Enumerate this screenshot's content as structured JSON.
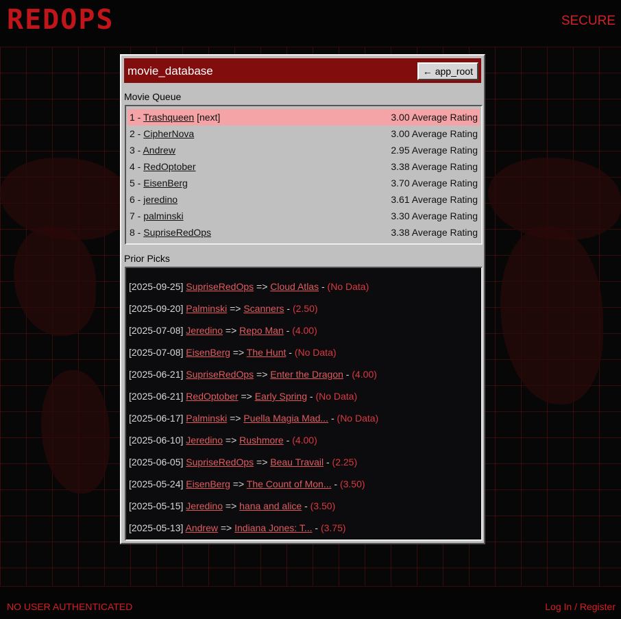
{
  "header": {
    "logo": "REDOPS",
    "status": "SECURE"
  },
  "footer": {
    "auth_status": "NO USER AUTHENTICATED",
    "login_link": "Log In / Register"
  },
  "window": {
    "title": "movie_database",
    "back_button": "app_root",
    "back_icon": "left-arrow-icon"
  },
  "queue": {
    "label": "Movie Queue",
    "items": [
      {
        "pos": "1 - ",
        "name": "Trashqueen",
        "tag": " [next]",
        "rating": "3.00 Average Rating",
        "active": true
      },
      {
        "pos": "2 - ",
        "name": "CipherNova",
        "tag": "",
        "rating": "3.00 Average Rating"
      },
      {
        "pos": "3 - ",
        "name": "Andrew",
        "tag": "",
        "rating": "2.95 Average Rating"
      },
      {
        "pos": "4 - ",
        "name": "RedOptober",
        "tag": "",
        "rating": "3.38 Average Rating"
      },
      {
        "pos": "5 - ",
        "name": "EisenBerg",
        "tag": "",
        "rating": "3.70 Average Rating"
      },
      {
        "pos": "6 - ",
        "name": "jeredino",
        "tag": "",
        "rating": "3.61 Average Rating"
      },
      {
        "pos": "7 - ",
        "name": "palminski",
        "tag": "",
        "rating": "3.30 Average Rating"
      },
      {
        "pos": "8 - ",
        "name": "SupriseRedOps",
        "tag": "",
        "rating": "3.38 Average Rating"
      }
    ]
  },
  "picks": {
    "label": "Prior Picks",
    "items": [
      {
        "date": "[2025-09-25] ",
        "user": "SupriseRedOps",
        "arrow": " => ",
        "movie": "Cloud Atlas",
        "sep": " - ",
        "rating": "(No Data)"
      },
      {
        "date": "[2025-09-20] ",
        "user": "Palminski",
        "arrow": " => ",
        "movie": "Scanners",
        "sep": " - ",
        "rating": "(2.50)"
      },
      {
        "date": "[2025-07-08] ",
        "user": "Jeredino",
        "arrow": " => ",
        "movie": "Repo Man",
        "sep": " - ",
        "rating": "(4.00)"
      },
      {
        "date": "[2025-07-08] ",
        "user": "EisenBerg",
        "arrow": " => ",
        "movie": "The Hunt",
        "sep": " - ",
        "rating": "(No Data)"
      },
      {
        "date": "[2025-06-21] ",
        "user": "SupriseRedOps",
        "arrow": " => ",
        "movie": "Enter the Dragon",
        "sep": " - ",
        "rating": "(4.00)"
      },
      {
        "date": "[2025-06-21] ",
        "user": "RedOptober",
        "arrow": " => ",
        "movie": "Early Spring",
        "sep": " - ",
        "rating": "(No Data)"
      },
      {
        "date": "[2025-06-17] ",
        "user": "Palminski",
        "arrow": " => ",
        "movie": "Puella Magia Mad...",
        "sep": " - ",
        "rating": "(No Data)"
      },
      {
        "date": "[2025-06-10] ",
        "user": "Jeredino",
        "arrow": " => ",
        "movie": "Rushmore",
        "sep": " - ",
        "rating": "(4.00)"
      },
      {
        "date": "[2025-06-05] ",
        "user": "SupriseRedOps",
        "arrow": " => ",
        "movie": "Beau Travail",
        "sep": " - ",
        "rating": "(2.25)"
      },
      {
        "date": "[2025-05-24] ",
        "user": "EisenBerg",
        "arrow": " => ",
        "movie": "The Count of Mon...",
        "sep": " - ",
        "rating": "(3.50)"
      },
      {
        "date": "[2025-05-15] ",
        "user": "Jeredino",
        "arrow": " => ",
        "movie": "hana and alice",
        "sep": " - ",
        "rating": "(3.50)"
      },
      {
        "date": "[2025-05-13] ",
        "user": "Andrew",
        "arrow": " => ",
        "movie": "Indiana Jones: T...",
        "sep": " - ",
        "rating": "(3.75)"
      }
    ]
  },
  "colors": {
    "accent": "#c0151a",
    "titlebar": "#820d0d",
    "active_row": "#f4a3a6",
    "link": "#e05a5e"
  }
}
